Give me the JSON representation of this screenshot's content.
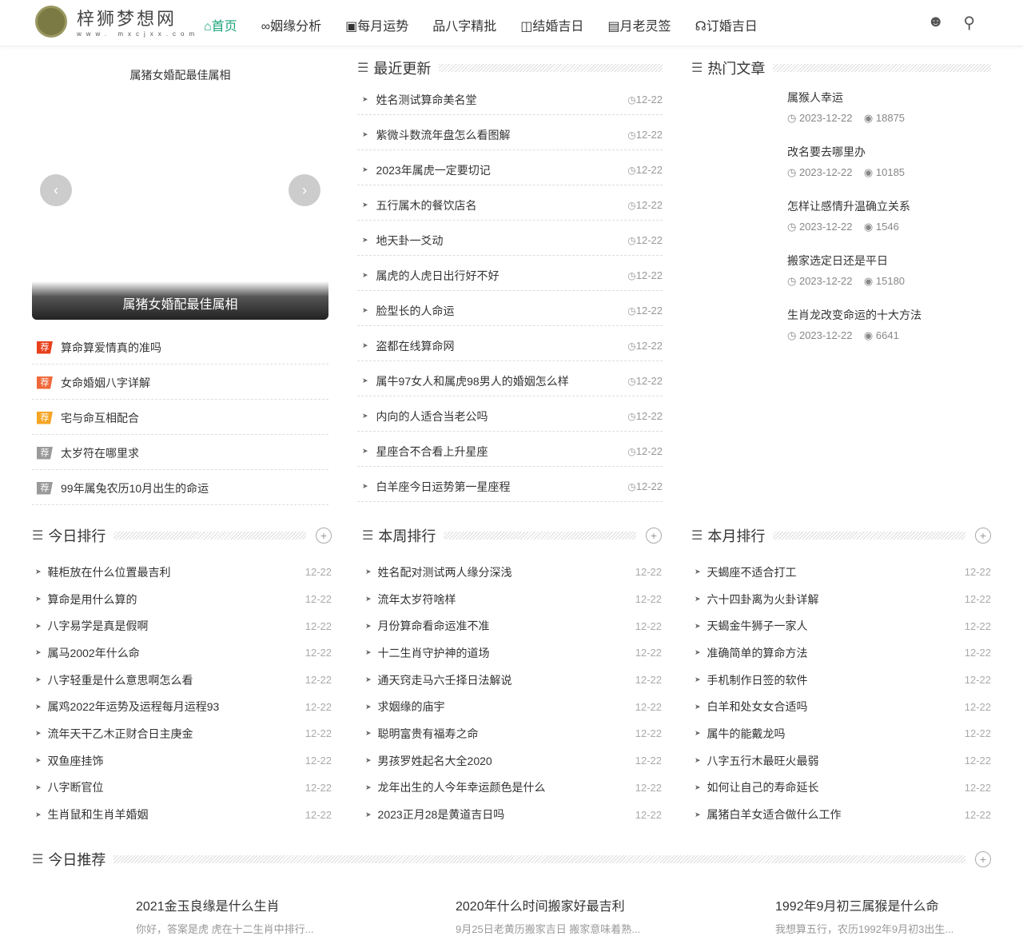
{
  "header": {
    "logo_name": "梓狮梦想网",
    "logo_url": "www. mxcjxx.com",
    "nav": [
      {
        "icon": "⌂",
        "label": "首页"
      },
      {
        "icon": "∞",
        "label": "姻缘分析"
      },
      {
        "icon": "▣",
        "label": "每月运势"
      },
      {
        "icon": "品",
        "label": "八字精批"
      },
      {
        "icon": "◫",
        "label": "结婚吉日"
      },
      {
        "icon": "▤",
        "label": "月老灵签"
      },
      {
        "icon": "☊",
        "label": "订婚吉日"
      }
    ]
  },
  "slider": {
    "caption_top": "属猪女婚配最佳属相",
    "caption": "属猪女婚配最佳属相",
    "prev": "‹",
    "next": "›"
  },
  "recommend": {
    "tag": "荐",
    "colors": [
      "#e8401c",
      "#f0683a",
      "#f5a524",
      "#999999",
      "#999999"
    ],
    "items": [
      "算命算爱情真的准吗",
      "女命婚姻八字详解",
      "宅与命互相配合",
      "太岁符在哪里求",
      "99年属兔农历10月出生的命运"
    ]
  },
  "recent": {
    "title": "最近更新",
    "items": [
      [
        "姓名测试算命美名堂",
        "12-22"
      ],
      [
        "紫微斗数流年盘怎么看图解",
        "12-22"
      ],
      [
        "2023年属虎一定要切记",
        "12-22"
      ],
      [
        "五行属木的餐饮店名",
        "12-22"
      ],
      [
        "地天卦一爻动",
        "12-22"
      ],
      [
        "属虎的人虎日出行好不好",
        "12-22"
      ],
      [
        "脸型长的人命运",
        "12-22"
      ],
      [
        "盗都在线算命网",
        "12-22"
      ],
      [
        "属牛97女人和属虎98男人的婚姻怎么样",
        "12-22"
      ],
      [
        "内向的人适合当老公吗",
        "12-22"
      ],
      [
        "星座合不合看上升星座",
        "12-22"
      ],
      [
        "白羊座今日运势第一星座程",
        "12-22"
      ]
    ]
  },
  "hot": {
    "title": "热门文章",
    "items": [
      [
        "属猴人幸运",
        "2023-12-22",
        "18875"
      ],
      [
        "改名要去哪里办",
        "2023-12-22",
        "10185"
      ],
      [
        "怎样让感情升温确立关系",
        "2023-12-22",
        "1546"
      ],
      [
        "搬家选定日还是平日",
        "2023-12-22",
        "15180"
      ],
      [
        "生肖龙改变命运的十大方法",
        "2023-12-22",
        "6641"
      ]
    ]
  },
  "ranks": [
    {
      "title": "今日排行",
      "items": [
        [
          "鞋柜放在什么位置最吉利",
          "12-22"
        ],
        [
          "算命是用什么算的",
          "12-22"
        ],
        [
          "八字易学是真是假啊",
          "12-22"
        ],
        [
          "属马2002年什么命",
          "12-22"
        ],
        [
          "八字轻重是什么意思啊怎么看",
          "12-22"
        ],
        [
          "属鸡2022年运势及运程每月运程93",
          "12-22"
        ],
        [
          "流年天干乙木正财合日主庚金",
          "12-22"
        ],
        [
          "双鱼座挂饰",
          "12-22"
        ],
        [
          "八字断官位",
          "12-22"
        ],
        [
          "生肖鼠和生肖羊婚姻",
          "12-22"
        ]
      ]
    },
    {
      "title": "本周排行",
      "items": [
        [
          "姓名配对测试两人缘分深浅",
          "12-22"
        ],
        [
          "流年太岁符啥样",
          "12-22"
        ],
        [
          "月份算命看命运准不准",
          "12-22"
        ],
        [
          "十二生肖守护神的道场",
          "12-22"
        ],
        [
          "通天窍走马六壬择日法解说",
          "12-22"
        ],
        [
          "求姻缘的庙宇",
          "12-22"
        ],
        [
          "聪明富贵有福寿之命",
          "12-22"
        ],
        [
          "男孩罗姓起名大全2020",
          "12-22"
        ],
        [
          "龙年出生的人今年幸运颜色是什么",
          "12-22"
        ],
        [
          "2023正月28是黄道吉日吗",
          "12-22"
        ]
      ]
    },
    {
      "title": "本月排行",
      "items": [
        [
          "天蝎座不适合打工",
          "12-22"
        ],
        [
          "六十四卦离为火卦详解",
          "12-22"
        ],
        [
          "天蝎金牛狮子一家人",
          "12-22"
        ],
        [
          "准确简单的算命方法",
          "12-22"
        ],
        [
          "手机制作日签的软件",
          "12-22"
        ],
        [
          "白羊和处女女合适吗",
          "12-22"
        ],
        [
          "属牛的能戴龙吗",
          "12-22"
        ],
        [
          "八字五行木最旺火最弱",
          "12-22"
        ],
        [
          "如何让自己的寿命延长",
          "12-22"
        ],
        [
          "属猪白羊女适合做什么工作",
          "12-22"
        ]
      ]
    }
  ],
  "today": {
    "title": "今日推荐",
    "items": [
      [
        "2021金玉良缘是什么生肖",
        "你好，答案是虎 虎在十二生肖中排行..."
      ],
      [
        "2020年什么时间搬家好最吉利",
        "9月25日老黄历搬家吉日 搬家意味着熟..."
      ],
      [
        "1992年9月初三属猴是什么命",
        "我想算五行，农历1992年9月初3出生..."
      ]
    ]
  }
}
